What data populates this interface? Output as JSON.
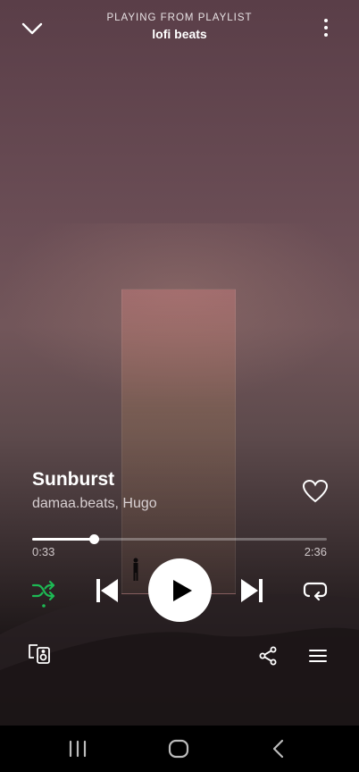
{
  "header": {
    "context_label": "PLAYING FROM PLAYLIST",
    "context_name": "lofi beats",
    "collapse_icon": "chevron-down-icon",
    "more_icon": "more-vertical-icon"
  },
  "track": {
    "title": "Sunburst",
    "artist": "damaa.beats, Hugo",
    "liked_icon": "heart-outline-icon"
  },
  "playback": {
    "elapsed": "0:33",
    "duration": "2:36",
    "progress": 0.21,
    "shuffle_active": true,
    "state": "paused"
  },
  "controls": [
    "shuffle-icon",
    "previous-icon",
    "play-icon",
    "next-icon",
    "repeat-icon"
  ],
  "extras": [
    "devices-icon",
    "share-icon",
    "queue-icon"
  ],
  "system_nav": [
    "recent-apps-icon",
    "home-icon",
    "back-icon"
  ],
  "colors": {
    "accent": "#1db954",
    "background": "#5a3e48",
    "text": "#ffffff"
  }
}
